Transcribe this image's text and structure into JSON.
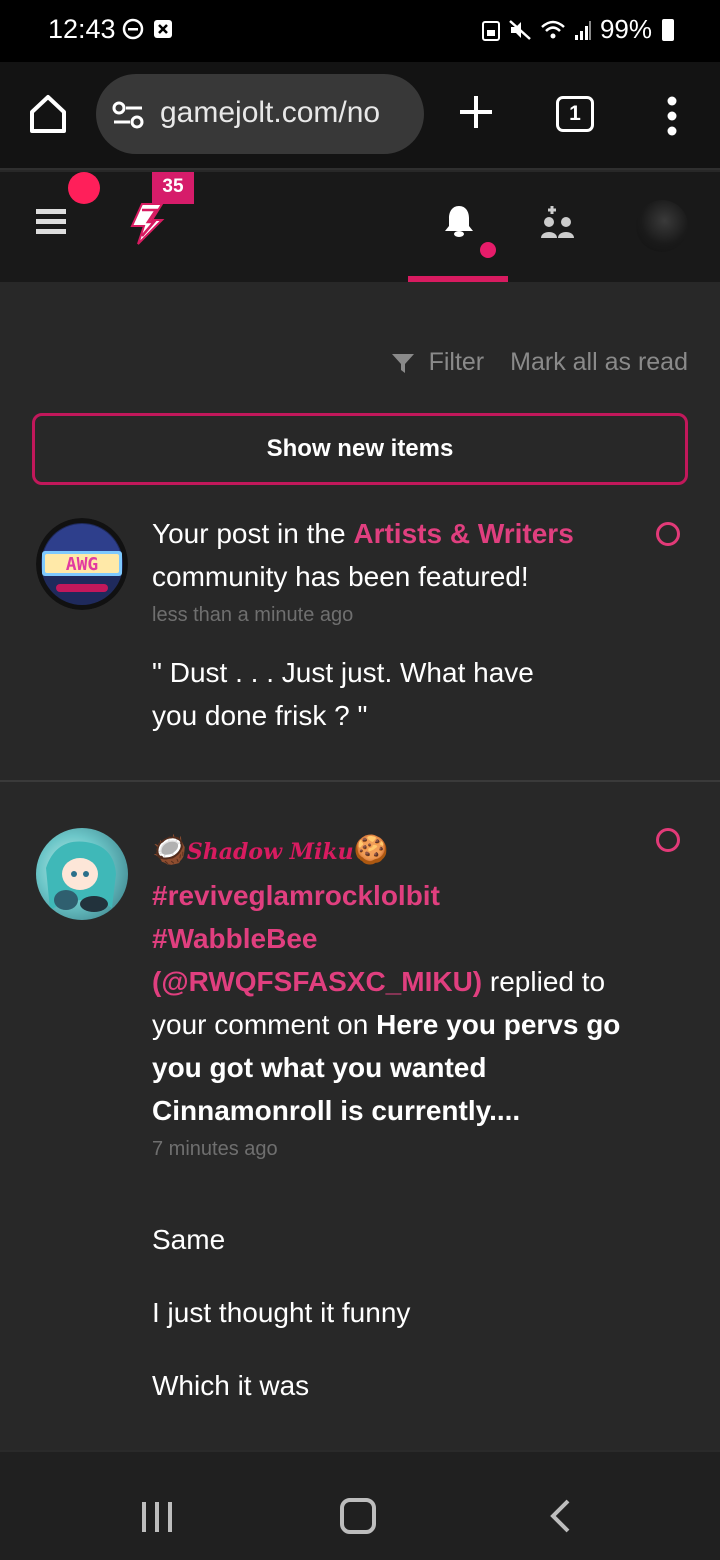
{
  "status_bar": {
    "time": "12:43",
    "battery": "99%",
    "icons": [
      "do-not-disturb-icon",
      "close-box-icon",
      "save-icon",
      "mute-icon",
      "wifi-icon",
      "signal-icon",
      "battery-icon"
    ]
  },
  "browser": {
    "url": "gamejolt.com/no",
    "tab_count": "1"
  },
  "app_nav": {
    "activity_count": "35",
    "colors": {
      "accent": "#d81b60",
      "dot": "#ff1f5a"
    }
  },
  "content": {
    "filter_label": "Filter",
    "mark_all_label": "Mark all as read",
    "show_new_label": "Show new items"
  },
  "notifications": [
    {
      "text_before": "Your post in the ",
      "community": "Artists & Writers",
      "text_after": " community has been featured!",
      "time": "less than a minute ago",
      "preview": [
        "\" Dust . . . Just just. What have you done frisk ? \""
      ]
    },
    {
      "display_name": "Shadow Miku",
      "hashtag1": "#reviveglamrocklolbit",
      "hashtag2": "#WabbleBee",
      "username": "(@RWQFSFASXC_MIKU)",
      "action": " replied to your comment on ",
      "post_title": "Here you pervs go you got what you wanted Cinnamonroll is currently....",
      "time": "7 minutes ago",
      "preview": [
        "Same",
        "I just thought it funny",
        "Which it was"
      ]
    }
  ]
}
